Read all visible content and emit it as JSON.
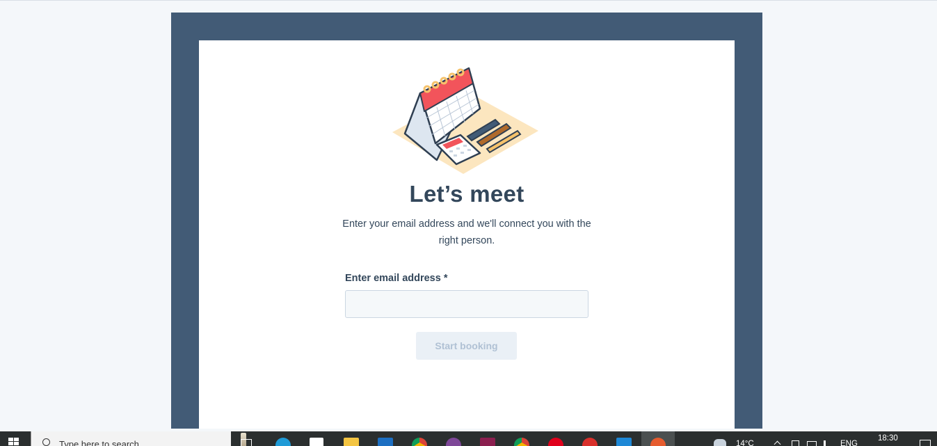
{
  "booking": {
    "title": "Let’s meet",
    "subtitle": "Enter your email address and we'll connect you with the right person.",
    "email_label": "Enter email address",
    "required_marker": "*",
    "email_value": "",
    "start_button": "Start booking"
  },
  "colors": {
    "frame": "#425b76",
    "heading": "#33475b",
    "button_disabled_bg": "#eaf0f6",
    "button_disabled_text": "#b0c1d4"
  },
  "taskbar": {
    "search_placeholder": "Type here to search",
    "pinned_apps": [
      {
        "icon": "task-view-icon"
      },
      {
        "icon": "edge-icon"
      },
      {
        "icon": "store-icon"
      },
      {
        "icon": "file-explorer-icon"
      },
      {
        "icon": "mail-icon"
      },
      {
        "icon": "chrome-icon"
      },
      {
        "icon": "tor-browser-icon"
      },
      {
        "icon": "winrar-icon"
      },
      {
        "icon": "chrome-icon"
      },
      {
        "icon": "opera-icon"
      },
      {
        "icon": "app-red-icon"
      },
      {
        "icon": "vscode-icon"
      },
      {
        "icon": "active-app-icon"
      }
    ],
    "weather": "14°C",
    "language": "ENG",
    "time": "18:30"
  }
}
